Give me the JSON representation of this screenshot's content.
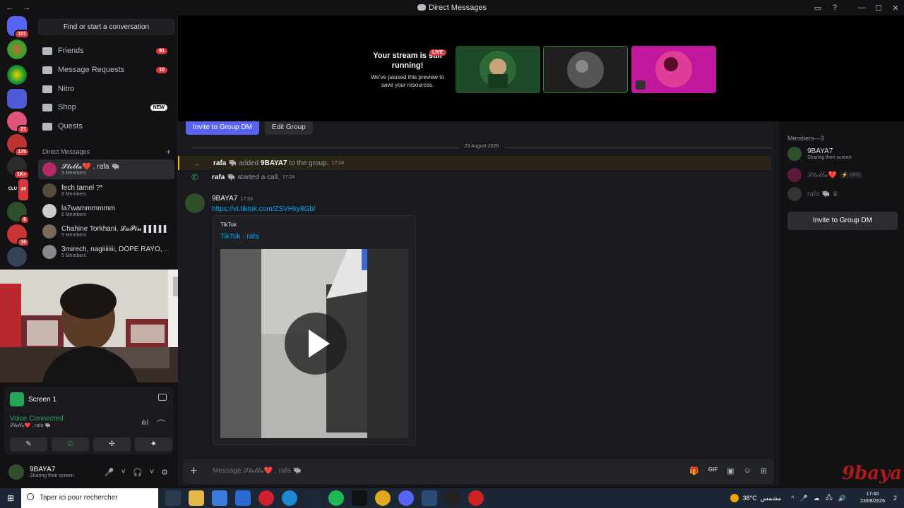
{
  "titlebar": {
    "title": "Direct Messages",
    "back": "←",
    "forward": "→",
    "controls": [
      "▭",
      "?",
      "—",
      "☐",
      "✕"
    ]
  },
  "rail": {
    "badges": [
      "101",
      "21",
      "175",
      "1K+",
      "46",
      "6",
      "16"
    ],
    "icon_labels": [
      "CLUTCH"
    ]
  },
  "sidebar": {
    "search_label": "Find or start a conversation",
    "nav": [
      {
        "label": "Friends",
        "count": "91",
        "icon": "friends-icon"
      },
      {
        "label": "Message Requests",
        "count": "10",
        "icon": "envelope-icon"
      },
      {
        "label": "Nitro",
        "count": "",
        "icon": "nitro-icon"
      },
      {
        "label": "Shop",
        "badge": "NEW",
        "icon": "shop-icon"
      },
      {
        "label": "Quests",
        "count": "",
        "icon": "quests-icon"
      }
    ],
    "dm_header": "Direct Messages",
    "dm_add": "+",
    "dms": [
      {
        "title": "𝓢𝓽𝓮𝓵𝓵𝓪❤️ , rafa 🐃",
        "sub": "3 Members",
        "active": true
      },
      {
        "title": "fech tamel ?*",
        "sub": "8 Members"
      },
      {
        "title": "la7wammmmmm",
        "sub": "6 Members"
      },
      {
        "title": "Chahine Torkhani, 𝓛𝓪𝓟𝓲𝓷 ▌▌▌▌▌l...",
        "sub": "5 Members"
      },
      {
        "title": "3mirech, nagiiiiiiii, DOPE RAYO, ...",
        "sub": "5 Members"
      }
    ]
  },
  "voice": {
    "screen_title": "Screen 1",
    "status": "Voice Connected",
    "channel": "𝓢𝓽𝓮𝓵𝓵𝓪❤️ , rafa 🐃",
    "buttons": [
      "✎",
      "⎚",
      "✣",
      "✷"
    ],
    "end_call": "⌒",
    "soundboard": "ılıl"
  },
  "user": {
    "name": "9BAYA7",
    "status": "Sharing their screen",
    "controls": [
      "🎤",
      "˅",
      "🎧",
      "˅",
      "⚙"
    ]
  },
  "stream": {
    "heading": "Your stream is still running!",
    "body": "We've paused this preview to save your resources.",
    "live": "LIVE"
  },
  "chat": {
    "invite_button": "Invite to Group DM",
    "edit_button": "Edit Group",
    "date_divider": "23 August 2026",
    "sys_added": {
      "actor": "rafa 🐃",
      "verb": "added",
      "target": "9BAYA7",
      "suffix": "to the group.",
      "time": "17:24"
    },
    "sys_call": {
      "actor": "rafa 🐃",
      "verb": "started a call.",
      "time": "17:24"
    },
    "message": {
      "author": "9BAYA7",
      "time": "17:33",
      "link": "https://vt.tiktok.com/ZSVHky8Gb/",
      "embed_provider": "TikTok",
      "embed_title": "TikTok · rafa"
    },
    "composer_placeholder": "Message 𝓢𝓽𝓮𝓵𝓵𝓪❤️ , rafa 🐃",
    "composer_tools": [
      "🎁",
      "GIF",
      "▣",
      "☺",
      "⊞"
    ]
  },
  "members": {
    "header": "Members—3",
    "list": [
      {
        "name": "9BAYA7",
        "status": "Sharing their screen",
        "tag": "",
        "dim": false
      },
      {
        "name": "𝓢𝓽𝓮𝓵𝓵𝓪❤️",
        "status": "",
        "tag": "⚡ HBM",
        "dim": true
      },
      {
        "name": "rafa 🐃 ♛",
        "status": "",
        "tag": "",
        "dim": true
      }
    ],
    "invite_button": "Invite to Group DM"
  },
  "watermark": "9baya7",
  "taskbar": {
    "start": "⊞",
    "search_placeholder": "Taper ici pour rechercher",
    "weather_temp": "38°C",
    "weather_text": "مشمس",
    "time": "17:40",
    "date": "23/08/2026",
    "notifications": "2",
    "tray_icons": [
      "^",
      "🎤",
      "☁",
      "🖧",
      "🔊"
    ]
  },
  "colors": {
    "accent": "#5865f2",
    "online": "#23a55a",
    "danger": "#da373c",
    "link": "#00a8fc"
  }
}
